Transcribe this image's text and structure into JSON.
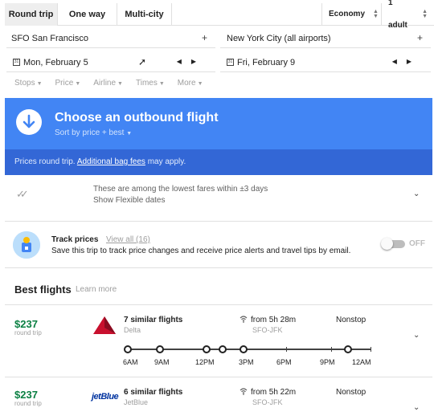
{
  "trip_types": [
    "Round trip",
    "One way",
    "Multi-city"
  ],
  "cabin": "Economy",
  "passengers": "1 adult",
  "origin": "SFO San Francisco",
  "destination": "New York City (all airports)",
  "depart_date": "Mon, February 5",
  "return_date": "Fri, February 9",
  "filters": [
    "Stops",
    "Price",
    "Airline",
    "Times",
    "More"
  ],
  "hero": {
    "title": "Choose an outbound flight",
    "sort": "Sort by price + best"
  },
  "notice": {
    "text": "Prices round trip.",
    "link": "Additional bag fees",
    "suffix": "may apply."
  },
  "flexible": {
    "line1": "These are among the lowest fares within ±3 days",
    "line2": "Show Flexible dates"
  },
  "track": {
    "title": "Track prices",
    "link": "View all (16)",
    "desc": "Save this trip to track price changes and receive price alerts and travel tips by email.",
    "toggle_label": "OFF",
    "enabled": false
  },
  "best": {
    "title": "Best flights",
    "learn": "Learn more"
  },
  "flights": [
    {
      "price": "$237",
      "price_note": "round trip",
      "title": "7 similar flights",
      "airline": "Delta",
      "duration": "from 5h 28m",
      "route": "SFO-JFK",
      "stops": "Nonstop",
      "timeline_labels": [
        "6AM",
        "9AM",
        "12PM",
        "3PM",
        "6PM",
        "9PM",
        "12AM"
      ]
    },
    {
      "price": "$237",
      "price_note": "round trip",
      "title": "6 similar flights",
      "airline": "JetBlue",
      "airline_logo": "jetBlue",
      "duration": "from 5h 22m",
      "route": "SFO-JFK",
      "stops": "Nonstop"
    }
  ],
  "colors": {
    "accent": "#4285f4",
    "accent_dark": "#3367d6",
    "price_green": "#0b8043",
    "delta_red": "#c8102e",
    "jetblue_navy": "#0033a0"
  }
}
